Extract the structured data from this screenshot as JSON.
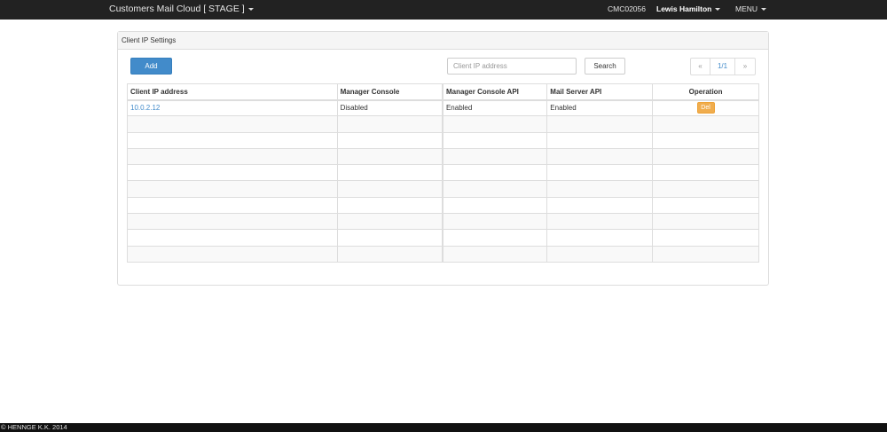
{
  "navbar": {
    "brand": "Customers Mail Cloud [ STAGE ]",
    "account_code": "CMC02056",
    "user_name": "Lewis Hamilton",
    "menu_label": "MENU"
  },
  "panel": {
    "title": "Client IP Settings",
    "add_label": "Add",
    "search_placeholder": "Client IP address",
    "search_label": "Search",
    "pager": {
      "prev": "«",
      "current": "1/1",
      "next": "»"
    }
  },
  "table": {
    "columns": [
      "Client IP address",
      "Manager Console",
      "Manager Console API",
      "Mail Server API",
      "Operation"
    ],
    "rows": [
      {
        "ip": "10.0.2.12",
        "manager_console": "Disabled",
        "manager_console_api": "Enabled",
        "mail_server_api": "Enabled",
        "operation": "Del"
      }
    ]
  },
  "footer": {
    "copyright": "© HENNGE K.K. 2014"
  }
}
